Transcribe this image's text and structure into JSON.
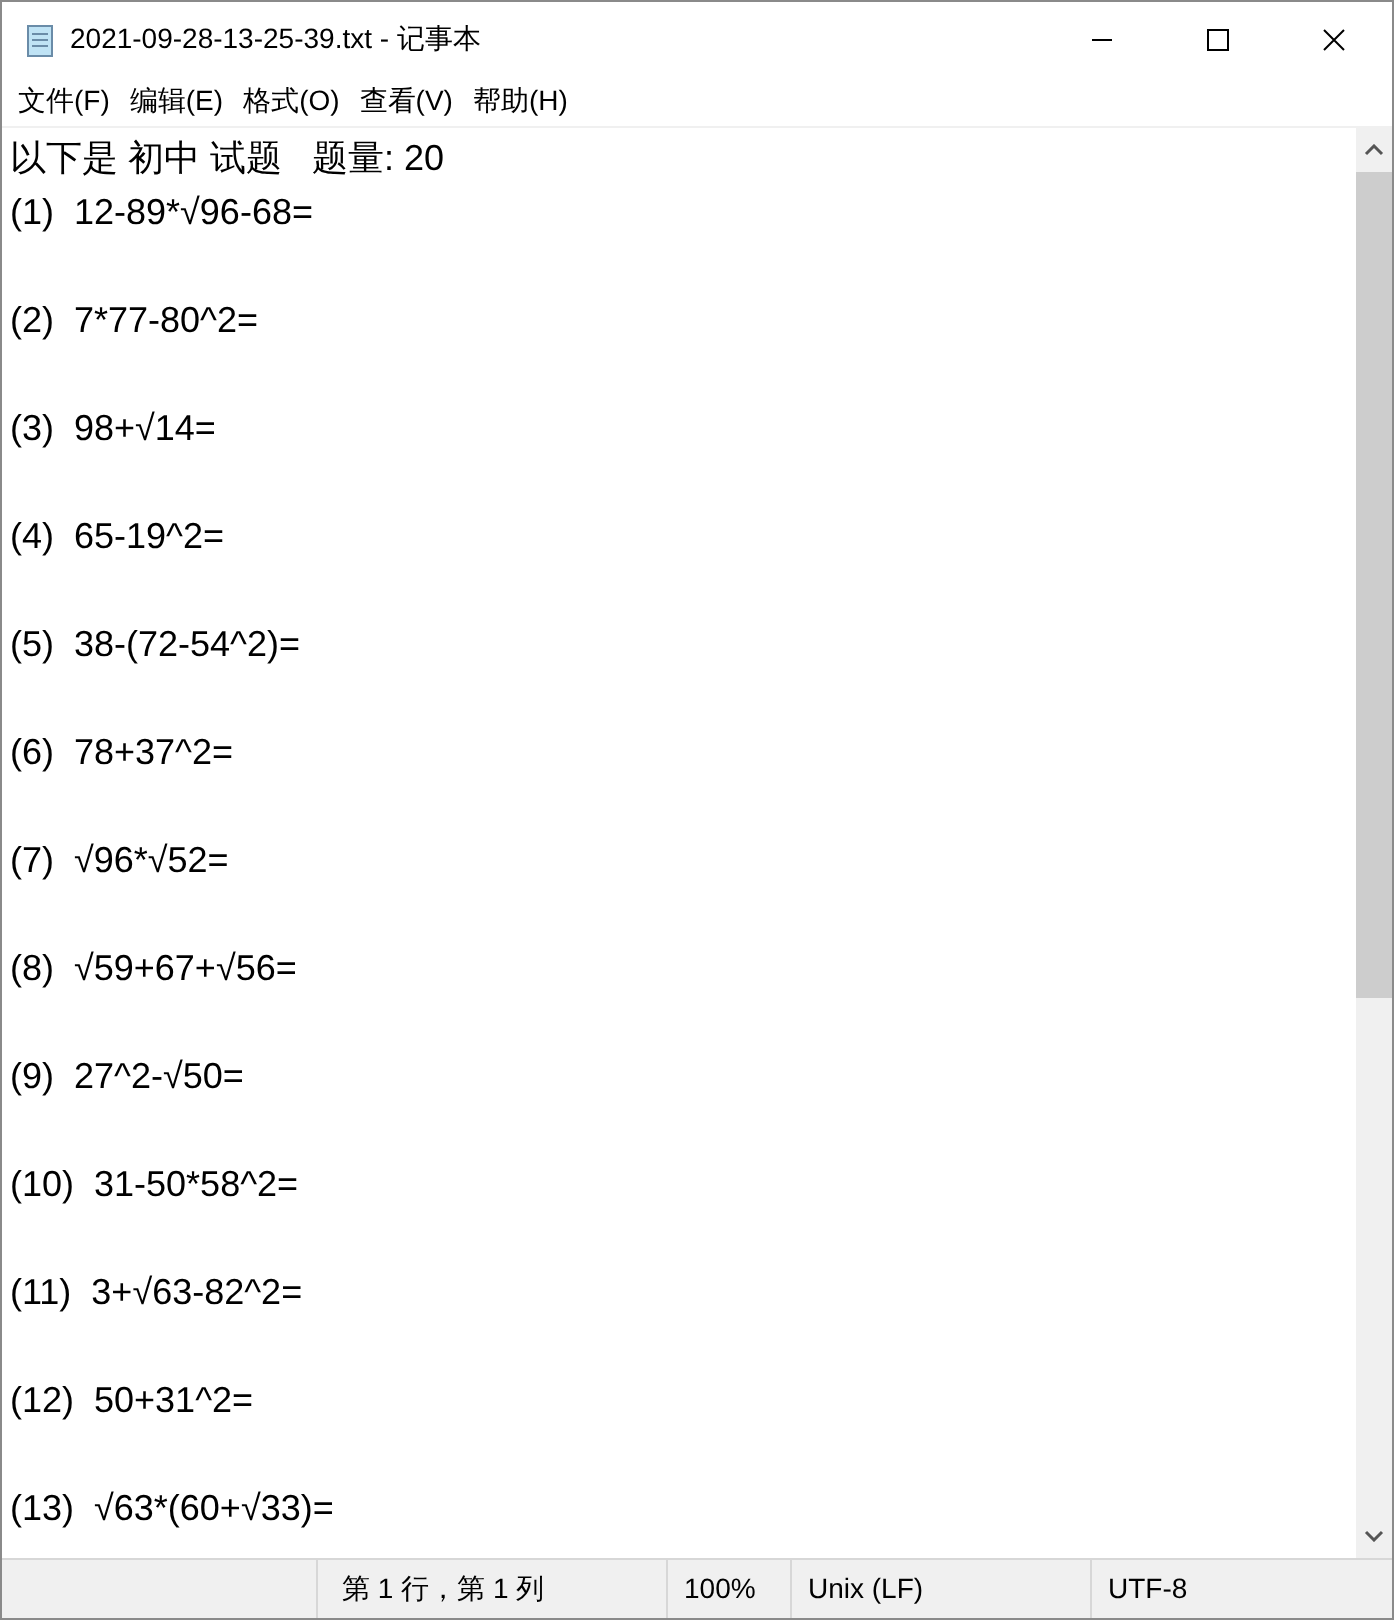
{
  "window": {
    "title": "2021-09-28-13-25-39.txt - 记事本"
  },
  "menu": [
    "文件(F)",
    "编辑(E)",
    "格式(O)",
    "查看(V)",
    "帮助(H)"
  ],
  "document": {
    "lines": [
      "以下是 初中 试题   题量: 20",
      "(1)  12-89*√96-68=",
      "(2)  7*77-80^2=",
      "(3)  98+√14=",
      "(4)  65-19^2=",
      "(5)  38-(72-54^2)=",
      "(6)  78+37^2=",
      "(7)  √96*√52=",
      "(8)  √59+67+√56=",
      "(9)  27^2-√50=",
      "(10)  31-50*58^2=",
      "(11)  3+√63-82^2=",
      "(12)  50+31^2=",
      "(13)  √63*(60+√33)="
    ]
  },
  "status_bar": {
    "position": "第 1 行，第 1 列",
    "zoom": "100%",
    "line_ending": "Unix (LF)",
    "encoding": "UTF-8"
  }
}
